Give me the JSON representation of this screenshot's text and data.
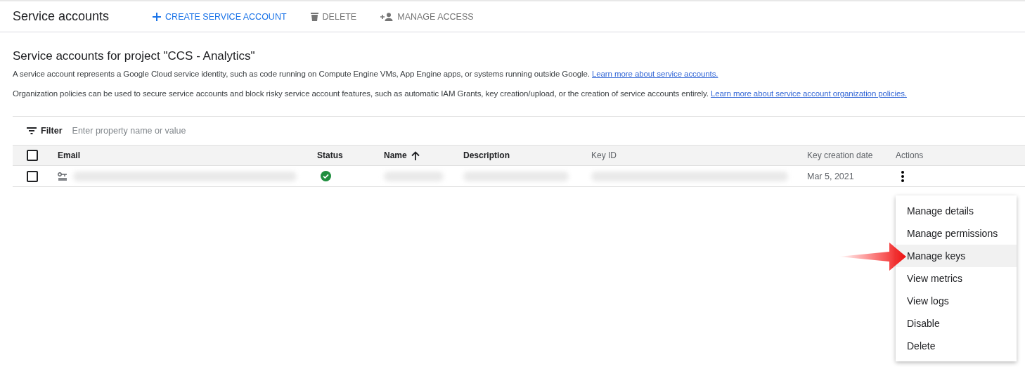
{
  "header": {
    "title": "Service accounts",
    "actions": [
      {
        "kind": "create",
        "label": "CREATE SERVICE ACCOUNT",
        "disabled": false
      },
      {
        "kind": "delete",
        "label": "DELETE",
        "disabled": true
      },
      {
        "kind": "access",
        "label": "MANAGE ACCESS",
        "disabled": true
      }
    ]
  },
  "section": {
    "title": "Service accounts for project \"CCS - Analytics\"",
    "paragraphs": [
      {
        "text": "A service account represents a Google Cloud service identity, such as code running on Compute Engine VMs, App Engine apps, or systems running outside Google.",
        "link": "Learn more about service accounts."
      },
      {
        "text": "Organization policies can be used to secure service accounts and block risky service account features, such as automatic IAM Grants, key creation/upload, or the creation of service accounts entirely.",
        "link": "Learn more about service account organization policies."
      }
    ]
  },
  "filter": {
    "label": "Filter",
    "placeholder": "Enter property name or value"
  },
  "table": {
    "select_all": {
      "checked": false
    },
    "columns": [
      {
        "label": "Email",
        "bold": true
      },
      {
        "label": "Status",
        "bold": true
      },
      {
        "label": "Name",
        "bold": true,
        "sorted_up": true
      },
      {
        "label": "Description",
        "bold": true
      },
      {
        "label": "Key ID",
        "bold": false
      },
      {
        "label": "Key creation date",
        "bold": false
      },
      {
        "label": "Actions",
        "bold": false
      }
    ],
    "rows": [
      {
        "checked": false,
        "cells": [
          {
            "kind": "account"
          },
          {
            "kind": "status",
            "ok": true
          },
          {
            "kind": "redacted"
          },
          {
            "kind": "redacted"
          },
          {
            "kind": "redacted"
          },
          {
            "kind": "text",
            "text": "Mar 5, 2021"
          },
          {
            "kind": "menu"
          }
        ]
      }
    ]
  },
  "menu": {
    "items": [
      {
        "label": "Manage details",
        "selected": false
      },
      {
        "label": "Manage permissions",
        "selected": false
      },
      {
        "label": "Manage keys",
        "selected": true
      },
      {
        "label": "View metrics",
        "selected": false
      },
      {
        "label": "View logs",
        "selected": false
      },
      {
        "label": "Disable",
        "selected": false
      },
      {
        "label": "Delete",
        "selected": false
      }
    ]
  }
}
